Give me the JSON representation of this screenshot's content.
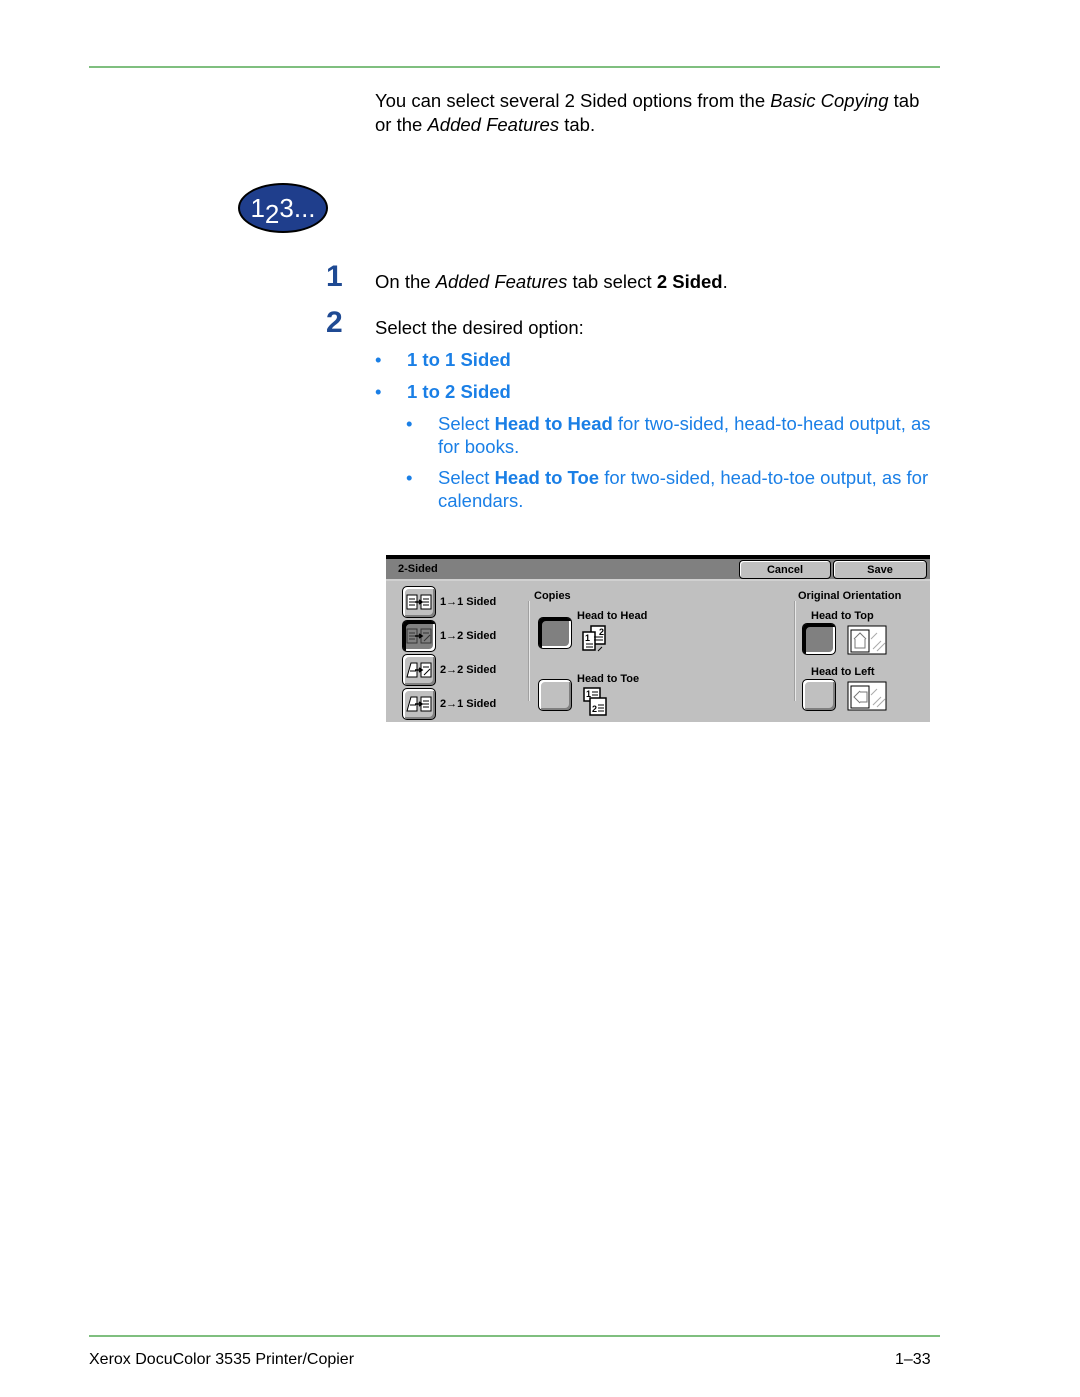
{
  "intro": {
    "part1": "You can select several 2 Sided options from the ",
    "italic1": "Basic Copying",
    "part2": " tab",
    "line2_part1": "or the ",
    "italic2": "Added Features",
    "line2_part2": " tab."
  },
  "badge": {
    "n1": "1",
    "n2": "2",
    "n3": "3..."
  },
  "steps": [
    {
      "num": "1",
      "pre": "On the ",
      "italic": "Added Features",
      "mid": " tab select ",
      "bold": "2 Sided",
      "post": "."
    },
    {
      "num": "2",
      "text": "Select the desired option:"
    }
  ],
  "options": [
    {
      "bullet": "•",
      "label": "1 to 1 Sided"
    },
    {
      "bullet": "•",
      "label": "1 to 2 Sided"
    }
  ],
  "suboptions": [
    {
      "bullet": "•",
      "pre": "Select ",
      "bold": "Head to Head",
      "post": " for two-sided, head-to-head output, as for books."
    },
    {
      "bullet": "•",
      "pre": "Select ",
      "bold": "Head to Toe",
      "post": " for two-sided, head-to-toe output, as for calendars."
    }
  ],
  "ui": {
    "title": "2-Sided",
    "cancel": "Cancel",
    "save": "Save",
    "sides": [
      {
        "label": "1→1 Sided",
        "selected": false,
        "icon": "one-to-one-sided-icon"
      },
      {
        "label": "1→2 Sided",
        "selected": true,
        "icon": "one-to-two-sided-icon"
      },
      {
        "label": "2→2 Sided",
        "selected": false,
        "icon": "two-to-two-sided-icon"
      },
      {
        "label": "2→1 Sided",
        "selected": false,
        "icon": "two-to-one-sided-icon"
      }
    ],
    "copies": {
      "label": "Copies",
      "head_to_head": "Head to Head",
      "head_to_toe": "Head to Toe",
      "selected": "Head to Head",
      "icon_page1": "1",
      "icon_page2": "2"
    },
    "orientation": {
      "label": "Original Orientation",
      "head_to_top": "Head to Top",
      "head_to_left": "Head to Left",
      "selected": "Head to Top"
    }
  },
  "footer": {
    "title": "Xerox DocuColor 3535 Printer/Copier",
    "page": "1–33"
  },
  "colors": {
    "accent_green": "#7fbf7f",
    "step_blue": "#1f4a93",
    "link_blue": "#1a7fe6",
    "badge_navy": "#1f3e8c"
  }
}
